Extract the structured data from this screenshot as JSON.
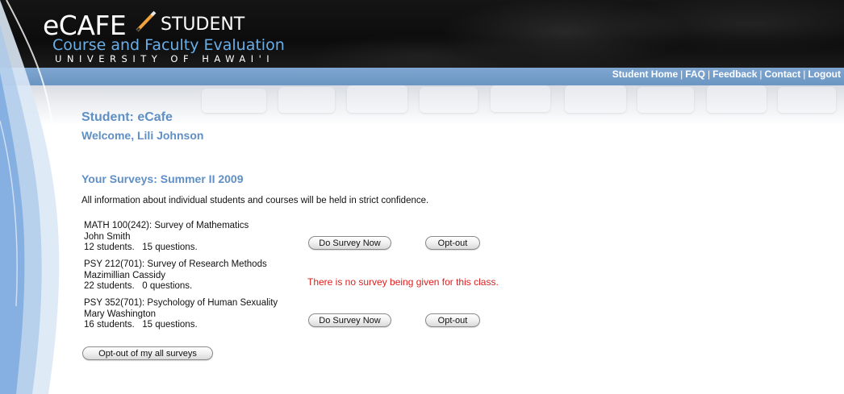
{
  "header": {
    "brand_main": "eCAFE",
    "brand_sub": "STUDENT",
    "subtitle": "Course and Faculty Evaluation",
    "university": "UNIVERSITY OF HAWAI'I"
  },
  "nav": {
    "items": [
      "Student Home",
      "FAQ",
      "Feedback",
      "Contact",
      "Logout"
    ],
    "separator": "|"
  },
  "page": {
    "title": "Student: eCafe",
    "welcome": "Welcome, Lili Johnson",
    "surveys_heading": "Your Surveys: Summer II 2009",
    "confidentiality": "All information about individual students and courses will be held in strict confidence."
  },
  "courses": [
    {
      "name": "MATH 100(242): Survey of Mathematics",
      "instructor": "John Smith",
      "stats": "12 students.   15 questions.",
      "do_survey_label": "Do Survey Now",
      "optout_label": "Opt-out"
    },
    {
      "name": "PSY 212(701): Survey of Research Methods",
      "instructor": "Mazimillian Cassidy",
      "stats": "22 students.   0 questions.",
      "message": "There is no survey being given for this class."
    },
    {
      "name": "PSY 352(701): Psychology of Human Sexuality",
      "instructor": "Mary Washington",
      "stats": "16 students.   15 questions.",
      "do_survey_label": "Do Survey Now",
      "optout_label": "Opt-out"
    }
  ],
  "optout_all_label": "Opt-out of my all surveys",
  "colors": {
    "header_bg": "#111111",
    "nav_bg": "#729dc9",
    "heading": "#5f8fc4",
    "warning": "#dd1f1f"
  }
}
